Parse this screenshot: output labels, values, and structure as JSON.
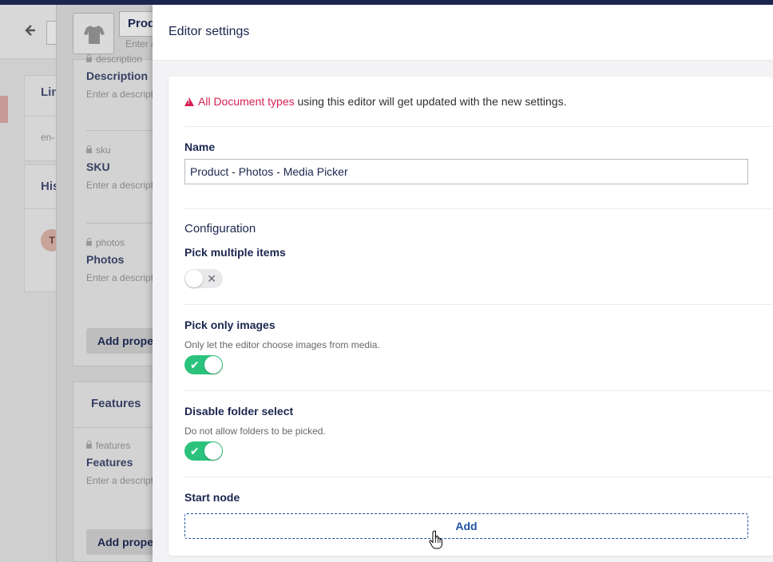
{
  "background": {
    "list_card_title": "Lin",
    "list_card_sub": "en-",
    "history_card_title": "His",
    "avatar_initial": "T"
  },
  "doc_type": {
    "name_partial": "Prod",
    "alias_placeholder": "Enter a",
    "icon": "sweater-icon",
    "groups": [
      {
        "properties": [
          {
            "alias": "description",
            "label": "Description",
            "desc": "Enter a descript"
          },
          {
            "alias": "sku",
            "label": "SKU",
            "desc": "Enter a descript"
          },
          {
            "alias": "photos",
            "label": "Photos",
            "desc": "Enter a descript"
          }
        ],
        "add_label": "Add prope"
      },
      {
        "name": "Features",
        "properties": [
          {
            "alias": "features",
            "label": "Features",
            "desc": "Enter a descript"
          }
        ],
        "add_label": "Add prope"
      }
    ]
  },
  "dialog": {
    "title": "Editor settings",
    "notice": {
      "highlight": "All Document types",
      "rest": " using this editor will get updated with the new settings."
    },
    "name_label": "Name",
    "name_value": "Product - Photos - Media Picker",
    "configuration_title": "Configuration",
    "settings": [
      {
        "label": "Pick multiple items",
        "description": "",
        "enabled": false
      },
      {
        "label": "Pick only images",
        "description": "Only let the editor choose images from media.",
        "enabled": true
      },
      {
        "label": "Disable folder select",
        "description": "Do not allow folders to be picked.",
        "enabled": true
      }
    ],
    "start_node_label": "Start node",
    "add_label": "Add"
  },
  "colors": {
    "primary": "#1b264f",
    "accent": "#d42054",
    "toggle_on": "#2bc37c",
    "link_blue": "#2152a3"
  }
}
